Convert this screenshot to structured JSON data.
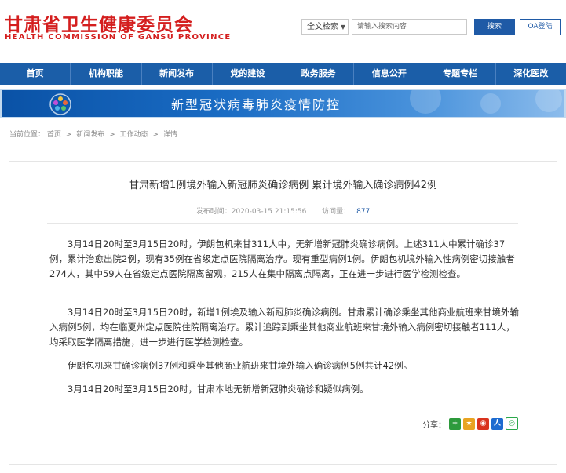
{
  "header": {
    "logo_cn": "甘肃省卫生健康委员会",
    "logo_en": "HEALTH COMMISSION OF GANSU PROVINCE",
    "search_scope": "全文检索",
    "search_placeholder": "请输入搜索内容",
    "search_button": "搜索",
    "oa_button": "OA登陆"
  },
  "nav": {
    "items": [
      "首页",
      "机构职能",
      "新闻发布",
      "党的建设",
      "政务服务",
      "信息公开",
      "专题专栏",
      "深化医改"
    ]
  },
  "banner": {
    "title": "新型冠状病毒肺炎疫情防控"
  },
  "breadcrumb": {
    "label": "当前位置：",
    "items": [
      "首页",
      "新闻发布",
      "工作动态",
      "详情"
    ],
    "sep": ">"
  },
  "article": {
    "title": "甘肃新增1例境外输入新冠肺炎确诊病例 累计境外输入确诊病例42例",
    "publish_label": "发布时间：",
    "publish_time": "2020-03-15 21:15:56",
    "visits_label": "访问量：",
    "visits": "877",
    "paragraphs": [
      "3月14日20时至3月15日20时，伊朗包机来甘311人中，无新增新冠肺炎确诊病例。上述311人中累计确诊37例，累计治愈出院2例，现有35例在省级定点医院隔离治疗。现有重型病例1例。伊朗包机境外输入性病例密切接触者274人，其中59人在省级定点医院隔离留观，215人在集中隔离点隔离，正在进一步进行医学检测检查。",
      "3月14日20时至3月15日20时，新增1例埃及输入新冠肺炎确诊病例。甘肃累计确诊乘坐其他商业航班来甘境外输入病例5例，均在临夏州定点医院住院隔离治疗。累计追踪到乘坐其他商业航班来甘境外输入病例密切接触者111人，均采取医学隔离措施，进一步进行医学检测检查。",
      "伊朗包机来甘确诊病例37例和乘坐其他商业航班来甘境外输入确诊病例5例共计42例。",
      "3月14日20时至3月15日20时，甘肃本地无新增新冠肺炎确诊和疑似病例。"
    ],
    "share_label": "分享："
  },
  "colors": {
    "brand_red": "#d41e1e",
    "nav_blue": "#1b5ea8",
    "link_blue": "#1f5aa6"
  },
  "share_icons": [
    "plus-share-icon",
    "qzone-star-icon",
    "weibo-icon",
    "renren-icon",
    "wechat-icon"
  ]
}
